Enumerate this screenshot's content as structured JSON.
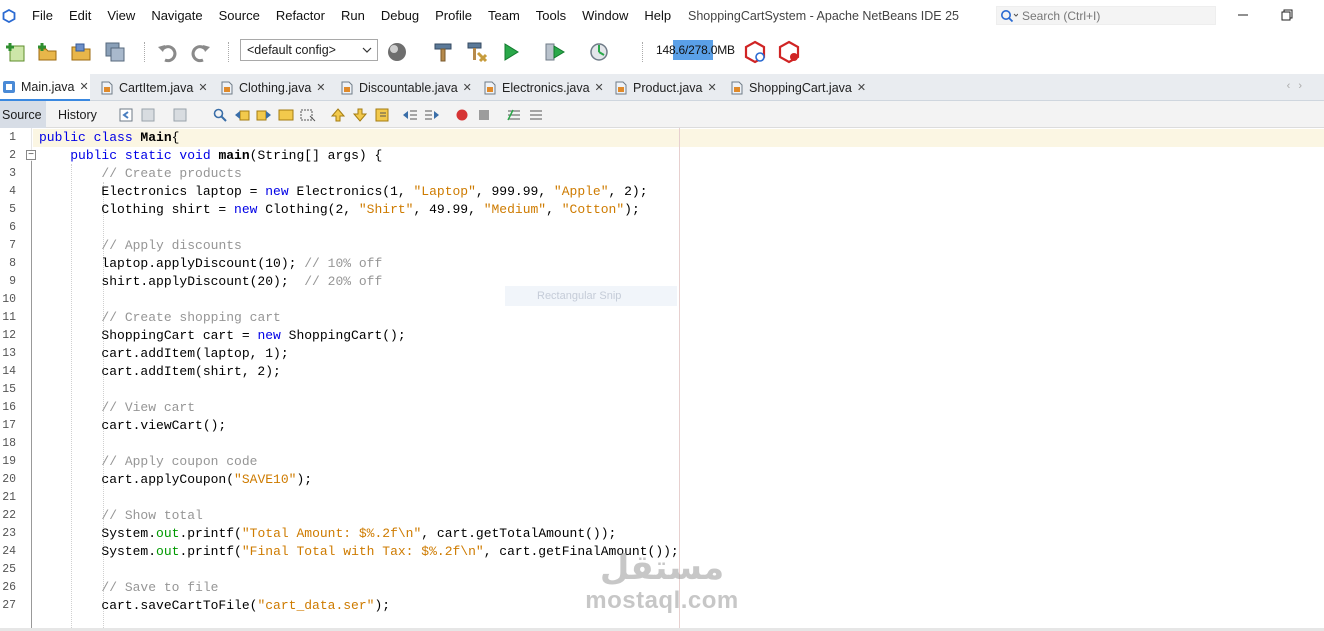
{
  "menubar": {
    "items": [
      "File",
      "Edit",
      "View",
      "Navigate",
      "Source",
      "Refactor",
      "Run",
      "Debug",
      "Profile",
      "Team",
      "Tools",
      "Window",
      "Help"
    ],
    "window_title": "ShoppingCartSystem - Apache NetBeans IDE 25",
    "search_placeholder": "Search (Ctrl+I)"
  },
  "toolbar": {
    "config_value": "<default config>",
    "memory_label": "148.6/278.0MB",
    "memory_used_fraction": 0.535,
    "icons": [
      "new-file-icon",
      "new-project-icon",
      "open-project-icon",
      "save-all-icon",
      "undo-icon",
      "redo-icon",
      "globe-icon",
      "build-hammer-icon",
      "clean-build-icon",
      "run-icon",
      "debug-icon",
      "profile-icon",
      "gc-icon",
      "profiler-snapshot-icon"
    ]
  },
  "tabs": [
    {
      "label": "Main.java",
      "active": true
    },
    {
      "label": "CartItem.java",
      "active": false
    },
    {
      "label": "Clothing.java",
      "active": false
    },
    {
      "label": "Discountable.java",
      "active": false
    },
    {
      "label": "Electronics.java",
      "active": false
    },
    {
      "label": "Product.java",
      "active": false
    },
    {
      "label": "ShoppingCart.java",
      "active": false
    }
  ],
  "editor_toolbar": {
    "source_label": "Source",
    "history_label": "History"
  },
  "editor": {
    "line_numbers": [
      "1",
      "2",
      "3",
      "4",
      "5",
      "6",
      "7",
      "8",
      "9",
      "10",
      "11",
      "12",
      "13",
      "14",
      "15",
      "16",
      "17",
      "18",
      "19",
      "20",
      "21",
      "22",
      "23",
      "24",
      "25",
      "26",
      "27"
    ],
    "ghost_tooltip": "Rectangular Snip",
    "lines": [
      [
        [
          "kw",
          "public class "
        ],
        [
          "bold",
          "Main"
        ],
        [
          "",
          "{"
        ]
      ],
      [
        [
          "",
          "    "
        ],
        [
          "kw",
          "public static void "
        ],
        [
          "bold",
          "main"
        ],
        [
          "",
          "(String[] args) {"
        ]
      ],
      [
        [
          "",
          "        "
        ],
        [
          "cm",
          "// Create products"
        ]
      ],
      [
        [
          "",
          "        Electronics laptop = "
        ],
        [
          "kw",
          "new"
        ],
        [
          "",
          " Electronics(1, "
        ],
        [
          "str",
          "\"Laptop\""
        ],
        [
          "",
          ", 999.99, "
        ],
        [
          "str",
          "\"Apple\""
        ],
        [
          "",
          ", 2);"
        ]
      ],
      [
        [
          "",
          "        Clothing shirt = "
        ],
        [
          "kw",
          "new"
        ],
        [
          "",
          " Clothing(2, "
        ],
        [
          "str",
          "\"Shirt\""
        ],
        [
          "",
          ", 49.99, "
        ],
        [
          "str",
          "\"Medium\""
        ],
        [
          "",
          ", "
        ],
        [
          "str",
          "\"Cotton\""
        ],
        [
          "",
          ");"
        ]
      ],
      [
        [
          "",
          ""
        ]
      ],
      [
        [
          "",
          "        "
        ],
        [
          "cm",
          "// Apply discounts"
        ]
      ],
      [
        [
          "",
          "        laptop.applyDiscount(10); "
        ],
        [
          "cm",
          "// 10% off"
        ]
      ],
      [
        [
          "",
          "        shirt.applyDiscount(20);  "
        ],
        [
          "cm",
          "// 20% off"
        ]
      ],
      [
        [
          "",
          ""
        ]
      ],
      [
        [
          "",
          "        "
        ],
        [
          "cm",
          "// Create shopping cart"
        ]
      ],
      [
        [
          "",
          "        ShoppingCart cart = "
        ],
        [
          "kw",
          "new"
        ],
        [
          "",
          " ShoppingCart();"
        ]
      ],
      [
        [
          "",
          "        cart.addItem(laptop, 1);"
        ]
      ],
      [
        [
          "",
          "        cart.addItem(shirt, 2);"
        ]
      ],
      [
        [
          "",
          ""
        ]
      ],
      [
        [
          "",
          "        "
        ],
        [
          "cm",
          "// View cart"
        ]
      ],
      [
        [
          "",
          "        cart.viewCart();"
        ]
      ],
      [
        [
          "",
          ""
        ]
      ],
      [
        [
          "",
          "        "
        ],
        [
          "cm",
          "// Apply coupon code"
        ]
      ],
      [
        [
          "",
          "        cart.applyCoupon("
        ],
        [
          "str",
          "\"SAVE10\""
        ],
        [
          "",
          ");"
        ]
      ],
      [
        [
          "",
          ""
        ]
      ],
      [
        [
          "",
          "        "
        ],
        [
          "cm",
          "// Show total"
        ]
      ],
      [
        [
          "",
          "        System."
        ],
        [
          "fld",
          "out"
        ],
        [
          "",
          ".printf("
        ],
        [
          "str",
          "\"Total Amount: $%.2f\\n\""
        ],
        [
          "",
          ", cart.getTotalAmount());"
        ]
      ],
      [
        [
          "",
          "        System."
        ],
        [
          "fld",
          "out"
        ],
        [
          "",
          ".printf("
        ],
        [
          "str",
          "\"Final Total with Tax: $%.2f\\n\""
        ],
        [
          "",
          ", cart.getFinalAmount());"
        ]
      ],
      [
        [
          "",
          ""
        ]
      ],
      [
        [
          "",
          "        "
        ],
        [
          "cm",
          "// Save to file"
        ]
      ],
      [
        [
          "",
          "        cart.saveCartToFile("
        ],
        [
          "str",
          "\"cart_data.ser\""
        ],
        [
          "",
          ");"
        ]
      ]
    ]
  },
  "watermark": {
    "arabic": "مستقل",
    "latin": "mostaql.com"
  }
}
